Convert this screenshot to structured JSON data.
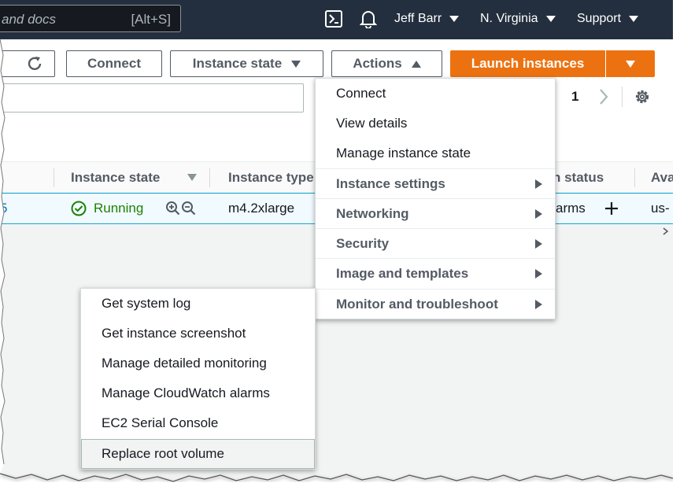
{
  "topbar": {
    "search_placeholder": "and docs",
    "search_shortcut": "[Alt+S]",
    "user": "Jeff Barr",
    "region": "N. Virginia",
    "support": "Support"
  },
  "toolbar": {
    "connect": "Connect",
    "instance_state": "Instance state",
    "actions": "Actions",
    "launch": "Launch instances"
  },
  "pager": {
    "current_page": "1"
  },
  "table": {
    "headers": [
      "Instance state",
      "Instance type",
      "n status",
      "Ava"
    ],
    "row": {
      "id_fragment": "5",
      "state": "Running",
      "type": "m4.2xlarge",
      "alarms": "arms",
      "az": "us-"
    }
  },
  "actions_menu": {
    "items": [
      "Connect",
      "View details",
      "Manage instance state"
    ],
    "groups": [
      "Instance settings",
      "Networking",
      "Security",
      "Image and templates",
      "Monitor and troubleshoot"
    ]
  },
  "monitor_submenu": {
    "items": [
      "Get system log",
      "Get instance screenshot",
      "Manage detailed monitoring",
      "Manage CloudWatch alarms",
      "EC2 Serial Console",
      "Replace root volume"
    ],
    "selected_index": 5
  },
  "colors": {
    "nav_bg": "#232f3e",
    "primary": "#ec7211",
    "running": "#1d8102",
    "link": "#0073bb"
  }
}
